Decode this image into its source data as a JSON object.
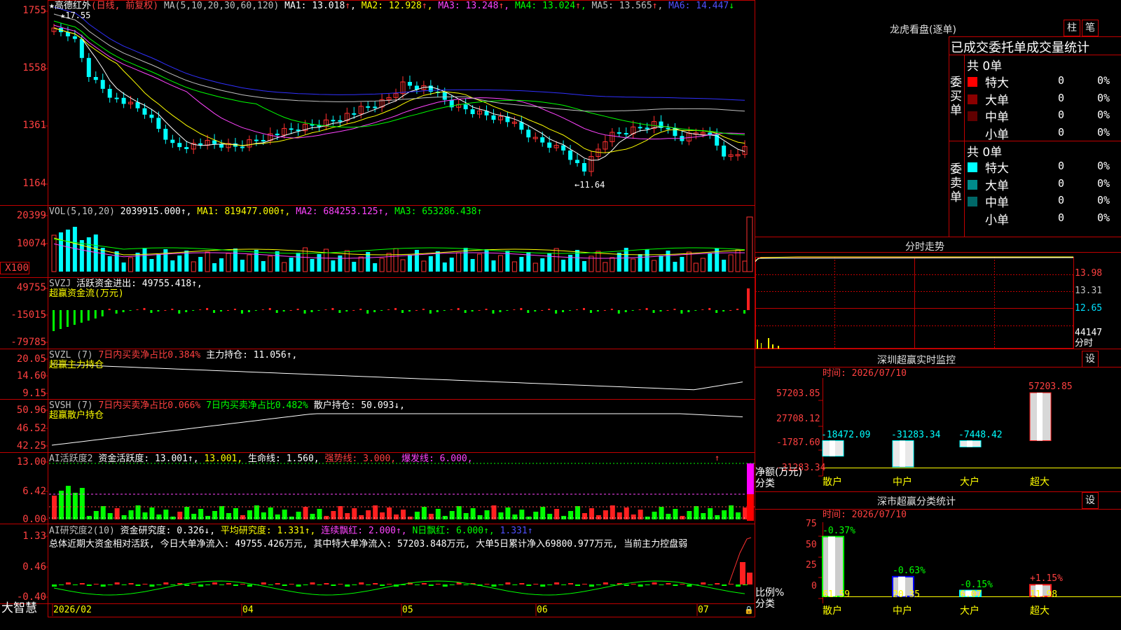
{
  "kline": {
    "title": "★高德红外",
    "period": "(日线, 前复权)",
    "ma_label": "MA(5,10,20,30,60,120)",
    "ma": [
      {
        "label": "MA1:",
        "value": "13.018",
        "arrow": "↑",
        "color": "#ffffff"
      },
      {
        "label": "MA2:",
        "value": "12.928",
        "arrow": "↑",
        "color": "#ffff00"
      },
      {
        "label": "MA3:",
        "value": "13.248",
        "arrow": "↑",
        "color": "#ff44ff"
      },
      {
        "label": "MA4:",
        "value": "13.024",
        "arrow": "↑",
        "color": "#00ff00"
      },
      {
        "label": "MA5:",
        "value": "13.565",
        "arrow": "↑",
        "color": "#c0c0c0"
      },
      {
        "label": "MA6:",
        "value": "14.447",
        "arrow": "↓",
        "color": "#3030ff"
      }
    ],
    "yaxis": [
      "1755",
      "1558",
      "1361",
      "1164"
    ],
    "high_mark": "17.55",
    "low_mark": "←11.64"
  },
  "vol": {
    "label": "VOL(5,10,20)",
    "value": "2039915.000↑,",
    "ma1": "MA1: 819477.000↑,",
    "ma2": "MA2: 684253.125↑,",
    "ma3": "MA3: 653286.438↑",
    "yaxis": [
      "20399",
      "10074",
      "X100"
    ]
  },
  "svzj": {
    "label": "SVZJ",
    "desc": "活跃资金进出: 49755.418↑,",
    "sub": "超赢资金流(万元)",
    "yaxis": [
      "49755",
      "-15015",
      "-79785"
    ]
  },
  "svzl": {
    "label": "SVZL (7)",
    "a": "7日内买卖净占比0.384%",
    "b": "主力持仓: 11.056↑,",
    "sub": "超赢主力持仓",
    "yaxis": [
      "20.05",
      "14.60",
      "9.15"
    ]
  },
  "svsh": {
    "label": "SVSH (7)",
    "a": "7日内买卖净占比0.066%",
    "b": "7日内买卖净占比0.482%",
    "c": "散户持仓: 50.093↓,",
    "sub": "超赢散户持仓",
    "yaxis": [
      "50.96",
      "46.52",
      "42.25"
    ]
  },
  "ai1": {
    "label": "AI活跃度2",
    "a": "资金活跃度: 13.001↑,",
    "b": "13.001,",
    "c": "生命线: 1.560,",
    "d": "强势线: 3.000,",
    "e": "爆发线: 6.000,",
    "yaxis": [
      "13.00",
      "6.42",
      "0.00"
    ]
  },
  "ai2": {
    "label": "AI研究度2(10)",
    "a": "资金研究度: 0.326↓,",
    "b": "平均研究度: 1.331↑,",
    "c": "连续飘红: 2.000↑,",
    "d": "N日飘红: 6.000↑,",
    "e": "1.331↑",
    "summary": "总体近期大资金相对活跃, 今日大单净流入: 49755.426万元, 其中特大单净流入: 57203.848万元, 大单5日累计净入69800.977万元, 当前主力控盘弱",
    "yaxis": [
      "1.33",
      "0.46",
      "-0.40"
    ]
  },
  "xaxis": [
    "2026/02",
    "04",
    "05",
    "06",
    "07"
  ],
  "brand": "大智慧",
  "longhu": {
    "title": "龙虎看盘(逐单)",
    "btn1": "柱",
    "btn2": "笔",
    "subtitle": "已成交委托单成交量统计",
    "buy_label": "委买单",
    "sell_label": "委卖单",
    "buy_total": "共 0单",
    "sell_total": "共 0单",
    "buy_rows": [
      {
        "name": "特大",
        "count": "0",
        "pct": "0%",
        "color": "#ff0000"
      },
      {
        "name": "大单",
        "count": "0",
        "pct": "0%",
        "color": "#8b0000"
      },
      {
        "name": "中单",
        "count": "0",
        "pct": "0%",
        "color": "#600000"
      },
      {
        "name": "小单",
        "count": "0",
        "pct": "0%",
        "color": "#000000"
      }
    ],
    "sell_rows": [
      {
        "name": "特大",
        "count": "0",
        "pct": "0%",
        "color": "#00ffff"
      },
      {
        "name": "大单",
        "count": "0",
        "pct": "0%",
        "color": "#008b8b"
      },
      {
        "name": "中单",
        "count": "0",
        "pct": "0%",
        "color": "#006868"
      },
      {
        "name": "小单",
        "count": "0",
        "pct": "0%",
        "color": "#000000"
      }
    ]
  },
  "intraday": {
    "title": "分时走势",
    "yaxis": [
      "13.98",
      "13.31",
      "12.65",
      "44147"
    ],
    "bottom": "分时"
  },
  "monitor": {
    "title": "深圳超赢实时监控",
    "btn": "设",
    "time": "时间: 2026/07/10",
    "yaxis": [
      "57203.85",
      "27708.12",
      "-1787.60",
      "-31283.34"
    ],
    "ylabel1": "净额(万元)",
    "ylabel2": "分类",
    "categories": [
      "散户",
      "中户",
      "大户",
      "超大"
    ],
    "values": [
      -18472.09,
      -31283.34,
      -7448.42,
      57203.85
    ],
    "labels": [
      "-18472.09",
      "-31283.34",
      "-7448.42",
      "57203.85"
    ]
  },
  "classify": {
    "title": "深市超赢分类统计",
    "btn": "设",
    "time": "时间: 2026/07/10",
    "yaxis": [
      "75",
      "50",
      "25",
      "0"
    ],
    "ylabel1": "比例%",
    "ylabel2": "分类",
    "categories": [
      "散户",
      "中户",
      "大户",
      "超大"
    ],
    "values": [
      61.59,
      20.35,
      6.07,
      11.98
    ],
    "labels": [
      "61.59",
      "20.35",
      "6.07",
      "11.98"
    ],
    "changes": [
      "-0.37%",
      "-0.63%",
      "-0.15%",
      "+1.15%"
    ]
  },
  "chart_data": [
    {
      "type": "bar",
      "title": "深圳超赢实时监控",
      "ylabel": "净额(万元)",
      "xlabel": "分类",
      "categories": [
        "散户",
        "中户",
        "大户",
        "超大"
      ],
      "values": [
        -18472.09,
        -31283.34,
        -7448.42,
        57203.85
      ],
      "ylim": [
        -31283.34,
        57203.85
      ]
    },
    {
      "type": "bar",
      "title": "深市超赢分类统计",
      "ylabel": "比例%",
      "xlabel": "分类",
      "categories": [
        "散户",
        "中户",
        "大户",
        "超大"
      ],
      "values": [
        61.59,
        20.35,
        6.07,
        11.98
      ],
      "ylim": [
        0,
        75
      ]
    }
  ]
}
